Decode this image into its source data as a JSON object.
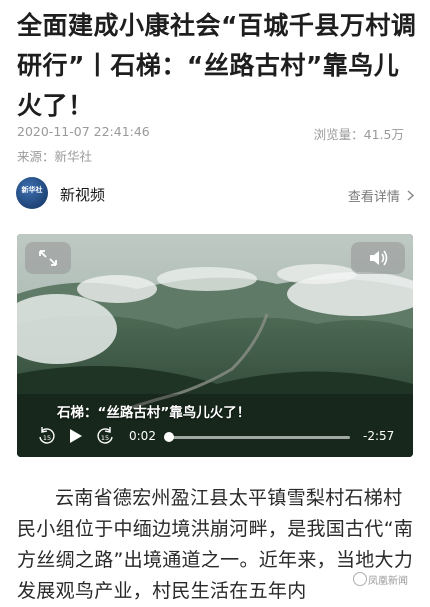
{
  "article": {
    "title": "全面建成小康社会“百城千县万村调研行”丨石梯：“丝路古村”靠鸟儿火了！",
    "date": "2020-11-07 22:41:46",
    "source": "来源：新华社",
    "views": "浏览量：41.5万"
  },
  "author": {
    "name": "新视频",
    "avatar_text": "新华社",
    "details_link": "查看详情"
  },
  "video": {
    "caption": "石梯：“丝路古村”靠鸟儿火了！",
    "current_time": "0:02",
    "remaining_time": "-2:57",
    "progress": 0.01,
    "icons": {
      "fullscreen": "expand-icon",
      "sound": "speaker-icon",
      "rewind": "rewind-15-icon",
      "play": "play-icon",
      "forward": "forward-15-icon"
    }
  },
  "body": {
    "paragraph": "云南省德宏州盈江县太平镇雪梨村石梯村民小组位于中缅边境洪崩河畔，是我国古代“南方丝绸之路”出境通道之一。近年来，当地大力发展观鸟产业，村民生活在五年内"
  },
  "watermark": "凤凰新闻"
}
